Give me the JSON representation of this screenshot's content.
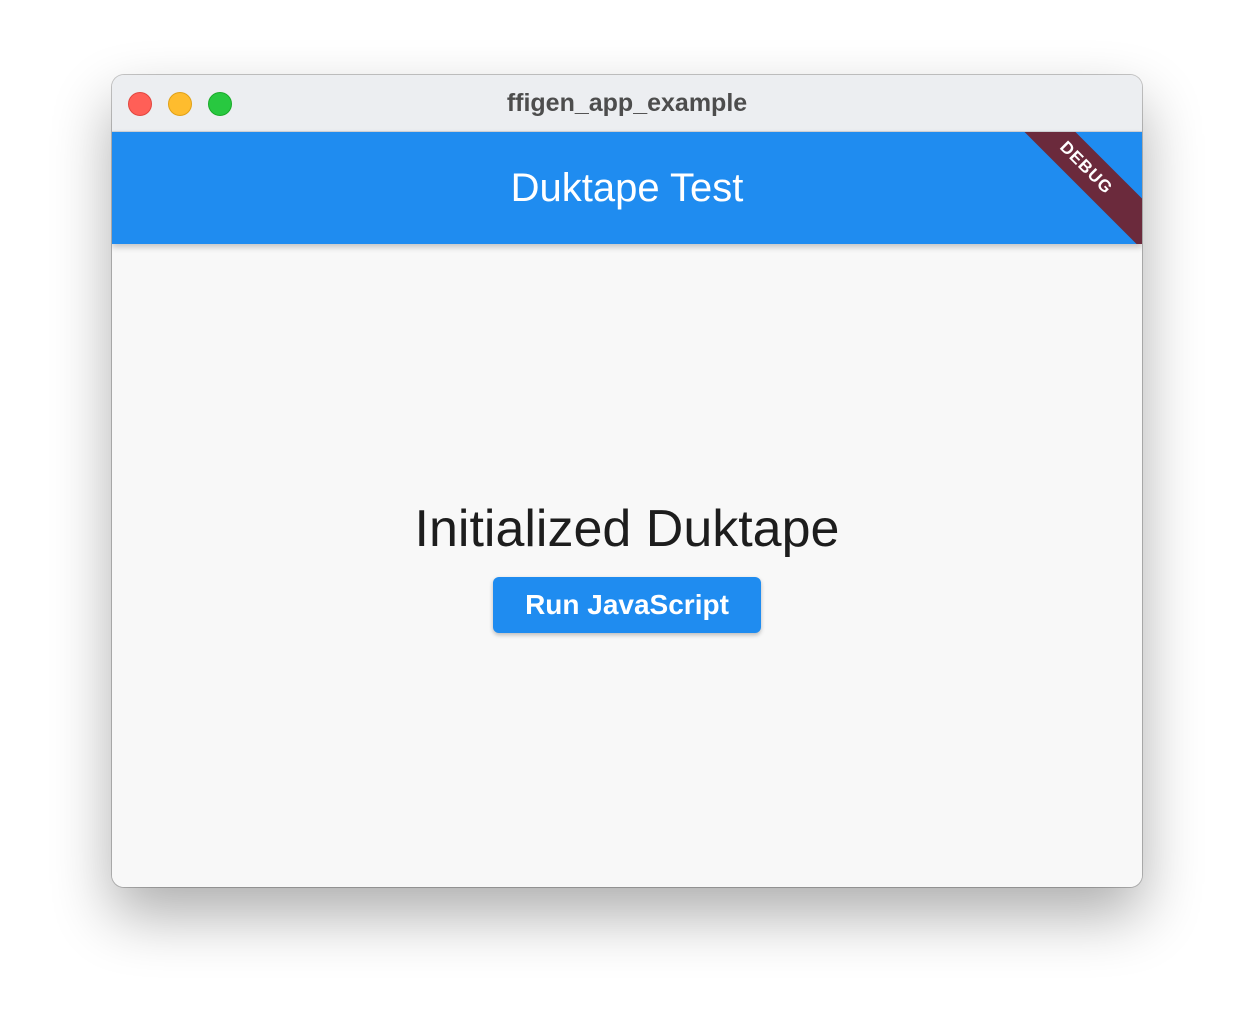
{
  "window": {
    "title": "ffigen_app_example"
  },
  "appbar": {
    "title": "Duktape Test",
    "color": "#1f8cf0"
  },
  "debug_banner": {
    "label": "DEBUG",
    "color": "#6b2a3c"
  },
  "main": {
    "status_text": "Initialized Duktape",
    "run_button_label": "Run JavaScript"
  }
}
